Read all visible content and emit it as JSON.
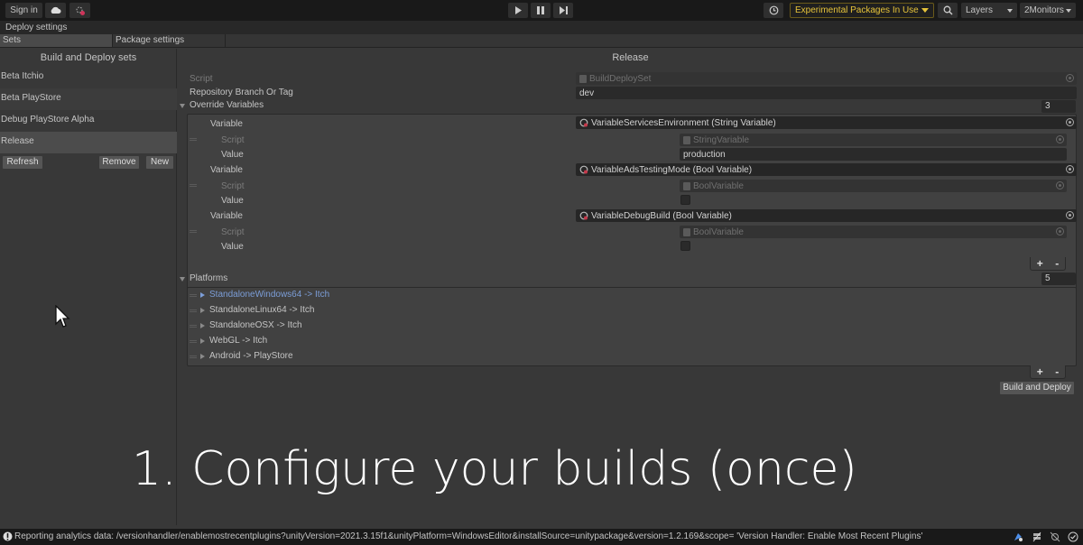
{
  "toolbar": {
    "sign_in": "Sign in",
    "cloud_icon": "cloud-icon",
    "collab_icon": "collab-error-icon",
    "play_icon": "play-icon",
    "pause_icon": "pause-icon",
    "step_icon": "step-icon",
    "history_icon": "history-icon",
    "experimental": "Experimental Packages In Use",
    "search_icon": "search-icon",
    "layers": "Layers",
    "layout": "2Monitors"
  },
  "window": {
    "title": "Deploy settings"
  },
  "tabs": [
    {
      "label": "Sets",
      "active": true
    },
    {
      "label": "Package settings",
      "active": false
    }
  ],
  "left": {
    "title": "Build and Deploy sets",
    "sets": [
      {
        "label": "Beta Itchio"
      },
      {
        "label": "Beta PlayStore"
      },
      {
        "label": "Debug PlayStore Alpha"
      },
      {
        "label": "Release",
        "selected": true
      }
    ],
    "buttons": {
      "refresh": "Refresh",
      "remove": "Remove",
      "new": "New"
    }
  },
  "inspector": {
    "title": "Release",
    "script_label": "Script",
    "script_value": "BuildDeploySet",
    "branch_label": "Repository Branch Or Tag",
    "branch_value": "dev",
    "override_label": "Override Variables",
    "override_count": "3",
    "variables": [
      {
        "label": "Variable",
        "value": "VariableServicesEnvironment (String Variable)",
        "script_label": "Script",
        "script_value": "StringVariable",
        "value_label": "Value",
        "field_value": "production",
        "type": "string"
      },
      {
        "label": "Variable",
        "value": "VariableAdsTestingMode (Bool Variable)",
        "script_label": "Script",
        "script_value": "BoolVariable",
        "value_label": "Value",
        "checked": false,
        "type": "bool"
      },
      {
        "label": "Variable",
        "value": "VariableDebugBuild (Bool Variable)",
        "script_label": "Script",
        "script_value": "BoolVariable",
        "value_label": "Value",
        "checked": false,
        "type": "bool"
      }
    ],
    "add": "+",
    "remove": "-",
    "platforms_label": "Platforms",
    "platforms_count": "5",
    "platforms": [
      {
        "label": "StandaloneWindows64 -> Itch",
        "selected": true
      },
      {
        "label": "StandaloneLinux64 -> Itch"
      },
      {
        "label": "StandaloneOSX -> Itch"
      },
      {
        "label": "WebGL -> Itch"
      },
      {
        "label": "Android -> PlayStore"
      }
    ],
    "build_deploy": "Build and Deploy"
  },
  "overlay": {
    "caption": "1. Configure your builds (once)"
  },
  "status": {
    "message": "Reporting analytics data: /versionhandler/enablemostrecentplugins?unityVersion=2021.3.15f1&unityPlatform=WindowsEditor&installSource=unitypackage&version=1.2.169&scope= 'Version Handler: Enable Most Recent Plugins'",
    "icons": [
      "info-icon",
      "progress-icon",
      "cache-server-icon",
      "debug-icon",
      "check-icon"
    ]
  }
}
